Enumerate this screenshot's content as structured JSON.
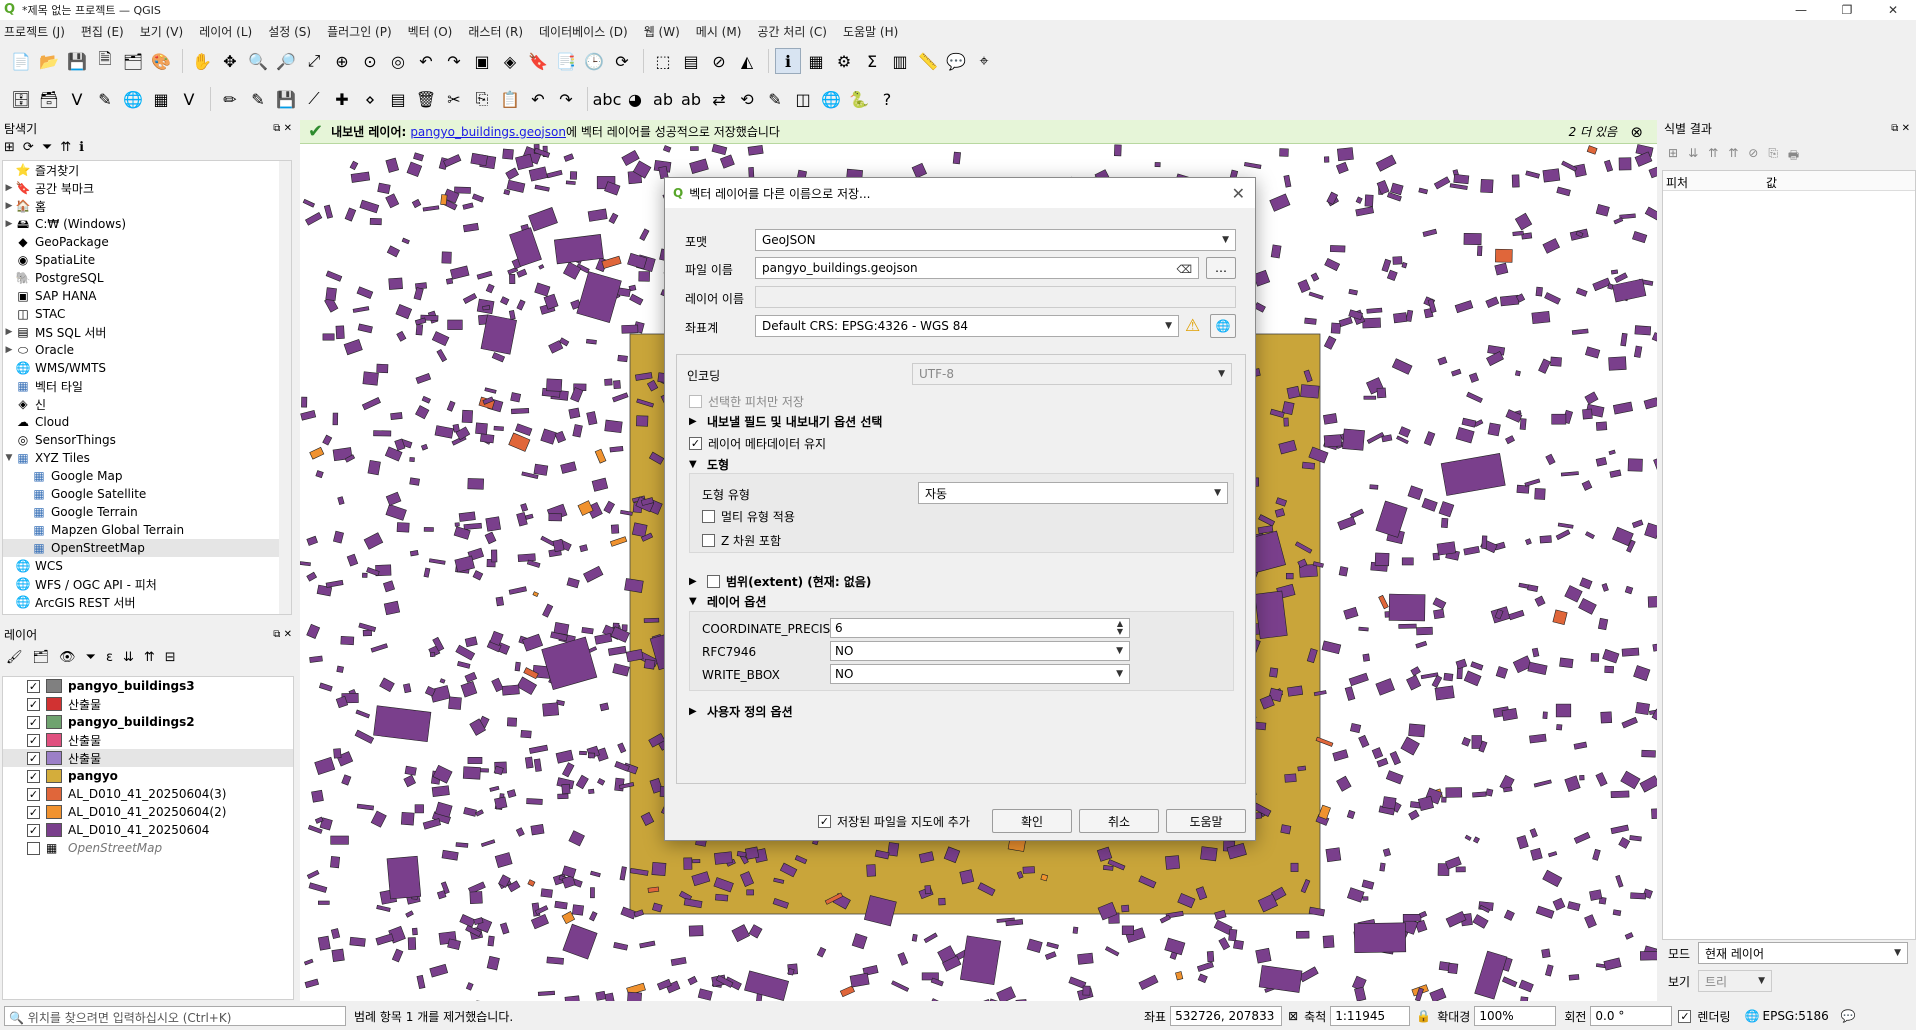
{
  "window": {
    "title": "*제목 없는 프로젝트 — QGIS"
  },
  "menu": [
    "프로젝트 (J)",
    "편집 (E)",
    "보기 (V)",
    "레이어 (L)",
    "설정 (S)",
    "플러그인 (P)",
    "벡터 (O)",
    "래스터 (R)",
    "데이터베이스 (D)",
    "웹 (W)",
    "메시 (M)",
    "공간 처리 (C)",
    "도움말 (H)"
  ],
  "browser": {
    "title": "탐색기",
    "items": [
      {
        "label": "즐겨찾기",
        "arrow": "",
        "icon": "star-icon"
      },
      {
        "label": "공간 북마크",
        "arrow": "▶",
        "icon": "bookmark-icon"
      },
      {
        "label": "홈",
        "arrow": "▶",
        "icon": "home-icon"
      },
      {
        "label": "C:₩ (Windows)",
        "arrow": "▶",
        "icon": "drive-icon"
      },
      {
        "label": "GeoPackage",
        "arrow": "",
        "icon": "geopackage-icon"
      },
      {
        "label": "SpatiaLite",
        "arrow": "",
        "icon": "spatialite-icon"
      },
      {
        "label": "PostgreSQL",
        "arrow": "",
        "icon": "postgresql-icon"
      },
      {
        "label": "SAP HANA",
        "arrow": "",
        "icon": "saphana-icon"
      },
      {
        "label": "STAC",
        "arrow": "",
        "icon": "stac-icon"
      },
      {
        "label": "MS SQL 서버",
        "arrow": "▶",
        "icon": "mssql-icon"
      },
      {
        "label": "Oracle",
        "arrow": "▶",
        "icon": "oracle-icon"
      },
      {
        "label": "WMS/WMTS",
        "arrow": "",
        "icon": "wms-icon"
      },
      {
        "label": "벡터 타일",
        "arrow": "",
        "icon": "vector-tile-icon"
      },
      {
        "label": "신",
        "arrow": "",
        "icon": "scene-icon"
      },
      {
        "label": "Cloud",
        "arrow": "",
        "icon": "cloud-icon"
      },
      {
        "label": "SensorThings",
        "arrow": "",
        "icon": "sensor-icon"
      },
      {
        "label": "XYZ Tiles",
        "arrow": "▼",
        "icon": "xyz-icon"
      },
      {
        "label": "Google Map",
        "arrow": "",
        "icon": "tile-icon",
        "indent": true
      },
      {
        "label": "Google Satellite",
        "arrow": "",
        "icon": "tile-icon",
        "indent": true
      },
      {
        "label": "Google Terrain",
        "arrow": "",
        "icon": "tile-icon",
        "indent": true
      },
      {
        "label": "Mapzen Global Terrain",
        "arrow": "",
        "icon": "tile-icon",
        "indent": true
      },
      {
        "label": "OpenStreetMap",
        "arrow": "",
        "icon": "tile-icon",
        "indent": true,
        "selected": true
      },
      {
        "label": "WCS",
        "arrow": "",
        "icon": "wcs-icon"
      },
      {
        "label": "WFS / OGC API - 피처",
        "arrow": "",
        "icon": "wfs-icon"
      },
      {
        "label": "ArcGIS REST 서버",
        "arrow": "",
        "icon": "arcgis-icon"
      }
    ]
  },
  "layers": {
    "title": "레이어",
    "items": [
      {
        "label": "pangyo_buildings3",
        "color": "#808080",
        "checked": true,
        "bold": true
      },
      {
        "label": "산출물",
        "color": "#d13232",
        "checked": true,
        "bold": false
      },
      {
        "label": "pangyo_buildings2",
        "color": "#6fa36f",
        "checked": true,
        "bold": true
      },
      {
        "label": "산출물",
        "color": "#e0507f",
        "checked": true,
        "bold": false
      },
      {
        "label": "산출물",
        "color": "#9b7fc7",
        "checked": true,
        "bold": false,
        "selected": true
      },
      {
        "label": "pangyo",
        "color": "#d4ad3b",
        "checked": true,
        "bold": true
      },
      {
        "label": "AL_D010_41_20250604(3)",
        "color": "#e0663a",
        "checked": true,
        "bold": false
      },
      {
        "label": "AL_D010_41_20250604(2)",
        "color": "#f0922f",
        "checked": true,
        "bold": false
      },
      {
        "label": "AL_D010_41_20250604",
        "color": "#7a3f8c",
        "checked": true,
        "bold": false
      },
      {
        "label": "OpenStreetMap",
        "color": "",
        "checked": false,
        "bold": false,
        "italic": true
      }
    ]
  },
  "message": {
    "prefix": "내보낸 레이어:",
    "link": "pangyo_buildings.geojson",
    "suffix": "에 벡터 레이어를 성공적으로 저장했습니다",
    "more": "2 더 있음"
  },
  "identify": {
    "title": "식별 결과",
    "col1": "피처",
    "col2": "값",
    "mode_label": "모드",
    "mode_value": "현재 레이어",
    "view_label": "보기",
    "view_value": "트리"
  },
  "dialog": {
    "title": "벡터 레이어를 다른 이름으로 저장...",
    "format_label": "포맷",
    "format_value": "GeoJSON",
    "filename_label": "파일 이름",
    "filename_value": "pangyo_buildings.geojson",
    "layername_label": "레이어 이름",
    "layername_value": "",
    "crs_label": "좌표계",
    "crs_value": "Default CRS: EPSG:4326 - WGS 84",
    "encoding_label": "인코딩",
    "encoding_value": "UTF-8",
    "selected_only": "선택한 피처만 저장",
    "fields_group": "내보낼 필드 및 내보내기 옵션 선택",
    "keep_metadata": "레이어 메타데이터 유지",
    "geometry_group": "도형",
    "geomtype_label": "도형 유형",
    "geomtype_value": "자동",
    "multi": "멀티 유형 적용",
    "z": "Z 차원 포함",
    "extent_group": "범위(extent) (현재: 없음)",
    "layer_options": "레이어 옵션",
    "opt1_label": "COORDINATE_PRECISION",
    "opt1_value": "6",
    "opt2_label": "RFC7946",
    "opt2_value": "NO",
    "opt3_label": "WRITE_BBOX",
    "opt3_value": "NO",
    "custom_options": "사용자 정의 옵션",
    "add_to_map": "저장된 파일을 지도에 추가",
    "ok": "확인",
    "cancel": "취소",
    "help": "도움말"
  },
  "status": {
    "locator_placeholder": "위치를 찾으려면 입력하십시오 (Ctrl+K)",
    "message": "범례 항목 1 개를 제거했습니다.",
    "coord_label": "좌표",
    "coord_value": "532726, 207833",
    "scale_label": "축척",
    "scale_value": "1:11945",
    "mag_label": "확대경",
    "mag_value": "100%",
    "rot_label": "회전",
    "rot_value": "0.0 °",
    "render_label": "렌더링",
    "crs": "EPSG:5186"
  }
}
